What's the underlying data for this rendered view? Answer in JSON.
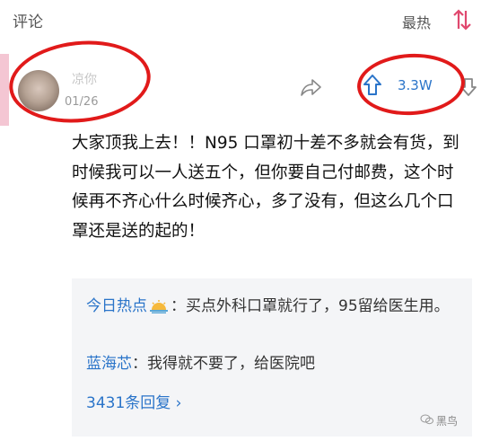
{
  "header": {
    "title": "评论",
    "sort_label": "最热"
  },
  "comment": {
    "username": "凉你",
    "date": "01/26",
    "upvotes": "3.3W",
    "text": "大家顶我上去！！N95 口罩初十差不多就会有货，到时候我可以一人送五个，但你要自己付邮费，这个时候再不齐心什么时候齐心，多了没有，但这么几个口罩还是送的起的！"
  },
  "replies": [
    {
      "name": "今日热点",
      "text": "：买点外科口罩就行了，95留给医生用。"
    },
    {
      "name": "蓝海芯",
      "text": "：我得就不要了，给医院吧"
    }
  ],
  "more_replies": "3431条回复 ›",
  "watermark": "黑鸟",
  "colors": {
    "link": "#2a74c9",
    "annotation": "#e11a1a",
    "reply_bg": "#f4f5f7"
  },
  "icons": [
    "sort-icon",
    "share-icon",
    "upvote-icon",
    "downvote-icon",
    "sun-emoji-icon",
    "wechat-icon"
  ]
}
